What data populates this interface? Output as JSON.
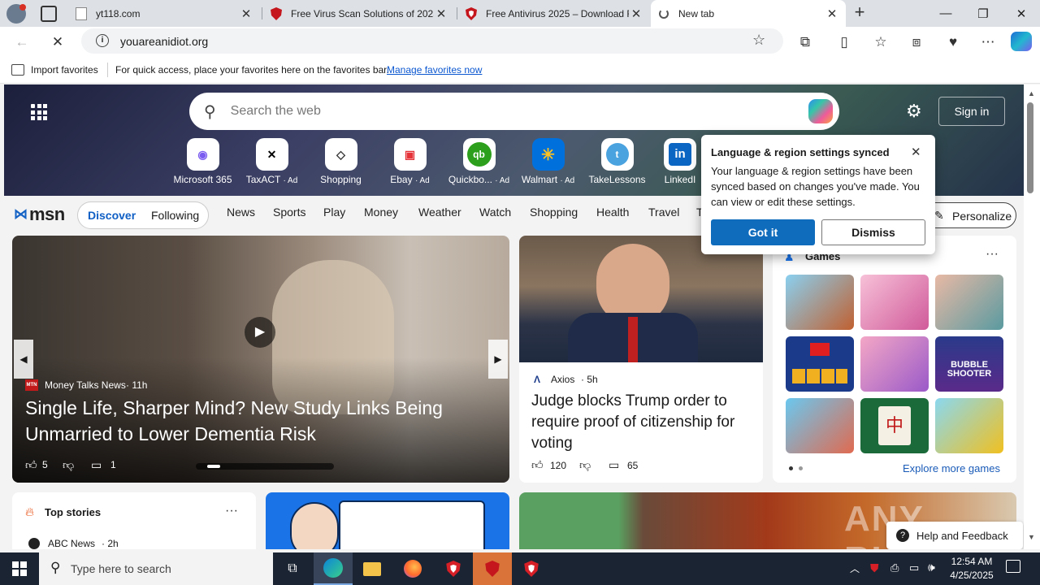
{
  "tabs": [
    {
      "title": "yt118.com",
      "icon": "page-icon"
    },
    {
      "title": "Free Virus Scan Solutions of 2025",
      "icon": "shield-icon"
    },
    {
      "title": "Free Antivirus 2025 – Download F",
      "icon": "shield-icon"
    },
    {
      "title": "New tab",
      "icon": "loading-icon"
    }
  ],
  "address": {
    "url": "youareanidiot.org"
  },
  "favbar": {
    "import_label": "Import favorites",
    "message": "For quick access, place your favorites here on the favorites bar.",
    "manage_link": "Manage favorites now"
  },
  "ntp": {
    "search_placeholder": "Search the web",
    "sign_in": "Sign in",
    "quick_links": [
      {
        "label": "Microsoft 365",
        "ad": ""
      },
      {
        "label": "TaxACT",
        "ad": "· Ad"
      },
      {
        "label": "Shopping",
        "ad": ""
      },
      {
        "label": "Ebay",
        "ad": "· Ad"
      },
      {
        "label": "Quickbo...",
        "ad": "· Ad"
      },
      {
        "label": "Walmart",
        "ad": "· Ad"
      },
      {
        "label": "TakeLessons",
        "ad": ""
      },
      {
        "label": "LinkedI",
        "ad": ""
      }
    ],
    "msn_logo": "msn",
    "pills": {
      "discover": "Discover",
      "following": "Following"
    },
    "nav_items": [
      "News",
      "Sports",
      "Play",
      "Money",
      "Weather",
      "Watch",
      "Shopping",
      "Health",
      "Travel",
      "T"
    ],
    "personalize": "Personalize"
  },
  "popup": {
    "title": "Language & region settings synced",
    "body": "Your language & region settings have been synced based on changes you've made. You can view or edit these settings.",
    "got_it": "Got it",
    "dismiss": "Dismiss"
  },
  "hero_story": {
    "source": "Money Talks News",
    "source_badge": "MTN",
    "age": "11h",
    "headline": "Single Life, Sharper Mind? New Study Links Being Unmarried to Lower Dementia Risk",
    "likes": "5",
    "comments": "1"
  },
  "second_story": {
    "source": "Axios",
    "age": "5h",
    "headline": "Judge blocks Trump order to require proof of citizenship for voting",
    "likes": "120",
    "comments": "65"
  },
  "games": {
    "title": "Games",
    "explore": "Explore more games",
    "tiles": [
      "BUBBLE SHOOTER"
    ]
  },
  "top_stories": {
    "title": "Top stories",
    "first_source": "ABC News",
    "first_age": "2h"
  },
  "help": {
    "label": "Help and Feedback"
  },
  "watermark": "ANY RUN",
  "taskbar": {
    "search_placeholder": "Type here to search",
    "time": "12:54 AM",
    "date": "4/25/2025"
  }
}
